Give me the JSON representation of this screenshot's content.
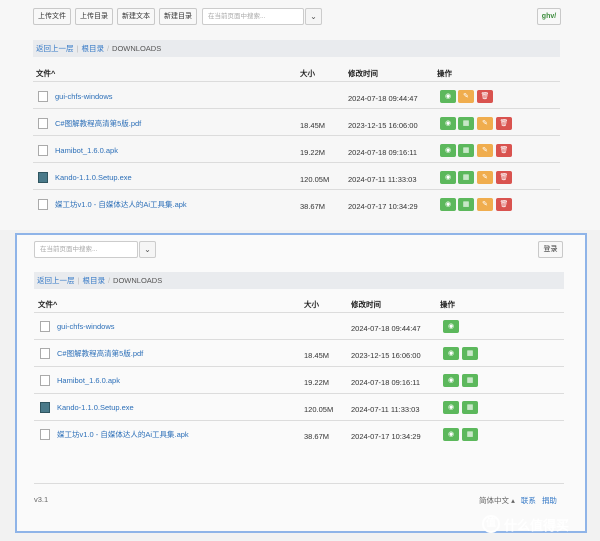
{
  "top": {
    "buttons": [
      "上传文件",
      "上传目录",
      "新建文本",
      "新建目录"
    ],
    "search_placeholder": "在当前页面中搜索...",
    "right_button": "ghv/",
    "breadcrumb": {
      "back": "返回上一层",
      "root": "根目录",
      "current": "DOWNLOADS"
    },
    "headers": {
      "name": "文件^",
      "size": "大小",
      "mtime": "修改时间",
      "ops": "操作"
    },
    "rows": [
      {
        "name": "gui-chfs-windows",
        "size": "",
        "mtime": "2024-07-18 09:44:47",
        "type": "dir"
      },
      {
        "name": "C#图解教程高清第5版.pdf",
        "size": "18.45M",
        "mtime": "2023-12-15 16:06:00",
        "type": "file"
      },
      {
        "name": "Hamibot_1.6.0.apk",
        "size": "19.22M",
        "mtime": "2024-07-18 09:16:11",
        "type": "file"
      },
      {
        "name": "Kando-1.1.0.Setup.exe",
        "size": "120.05M",
        "mtime": "2024-07-11 11:33:03",
        "type": "exe"
      },
      {
        "name": "媒工坊v1.0 - 自媒体达人的Ai工具集.apk",
        "size": "38.67M",
        "mtime": "2024-07-17 10:34:29",
        "type": "file"
      }
    ]
  },
  "bottom": {
    "search_placeholder": "在当前页面中搜索...",
    "login": "登录",
    "breadcrumb": {
      "back": "返回上一层",
      "root": "根目录",
      "current": "DOWNLOADS"
    },
    "headers": {
      "name": "文件^",
      "size": "大小",
      "mtime": "修改时间",
      "ops": "操作"
    },
    "rows": [
      {
        "name": "gui-chfs-windows",
        "size": "",
        "mtime": "2024-07-18 09:44:47",
        "type": "dir"
      },
      {
        "name": "C#图解教程高清第5版.pdf",
        "size": "18.45M",
        "mtime": "2023-12-15 16:06:00",
        "type": "file"
      },
      {
        "name": "Hamibot_1.6.0.apk",
        "size": "19.22M",
        "mtime": "2024-07-18 09:16:11",
        "type": "file"
      },
      {
        "name": "Kando-1.1.0.Setup.exe",
        "size": "120.05M",
        "mtime": "2024-07-11 11:33:03",
        "type": "exe"
      },
      {
        "name": "媒工坊v1.0 - 自媒体达人的Ai工具集.apk",
        "size": "38.67M",
        "mtime": "2024-07-17 10:34:29",
        "type": "file"
      }
    ],
    "version": "v3.1",
    "lang": "简体中文 ▴",
    "contact": "联系",
    "donate": "捐助"
  },
  "watermark": "什么值得买",
  "colors": {
    "green": "#5cb85c",
    "orange": "#f0ad4e",
    "red": "#d9534f",
    "link": "#3478c6",
    "frame": "#8fb4e8"
  }
}
